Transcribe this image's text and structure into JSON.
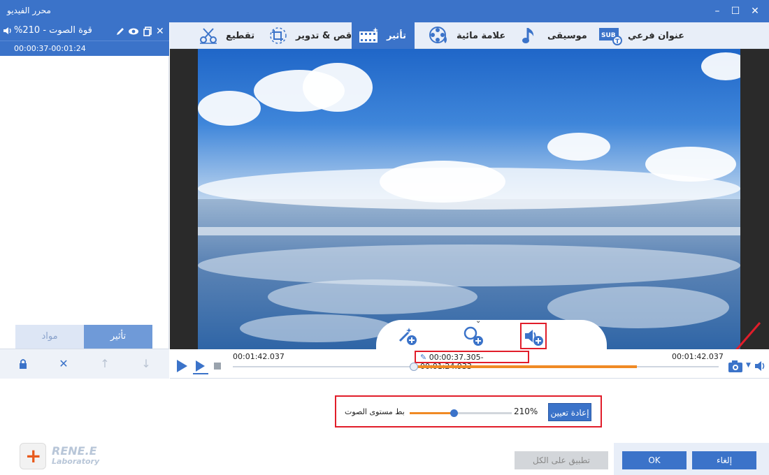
{
  "window": {
    "title": "محرر الفيديو"
  },
  "clip": {
    "title": "%قوة الصوت - 210",
    "time": "00:00:37-00:01:24"
  },
  "left_tabs": {
    "effect": "تأثير",
    "materials": "مواد"
  },
  "tabs": [
    {
      "label": "تقطيع",
      "icon": "scissors-icon"
    },
    {
      "label": "قص & تدوير",
      "icon": "crop-rotate-icon"
    },
    {
      "label": "تأثير",
      "icon": "film-effect-icon"
    },
    {
      "label": "علامة مائية",
      "icon": "watermark-icon"
    },
    {
      "label": "موسيقى",
      "icon": "music-note-icon"
    },
    {
      "label": "عنوان فرعي",
      "icon": "subtitle-icon"
    }
  ],
  "active_tab": "تأثير",
  "timeline": {
    "time_left": "00:01:42.037",
    "time_right": "00:01:42.037",
    "range": "00:00:37.305-00:01:24.933"
  },
  "volume": {
    "label": "بط مستوى الصوت",
    "percent_text": "210%",
    "level": 0.44,
    "reset_label": "إعادة تعيين"
  },
  "footer": {
    "apply_all": "تطبيق على الكل",
    "ok": "OK",
    "cancel": "إلغاء"
  },
  "logo": {
    "brand": "RENE.E",
    "sub": "Laboratory"
  },
  "colors": {
    "accent": "#3b73c9",
    "progress": "#f08a24",
    "highlight": "#e11d2a"
  }
}
